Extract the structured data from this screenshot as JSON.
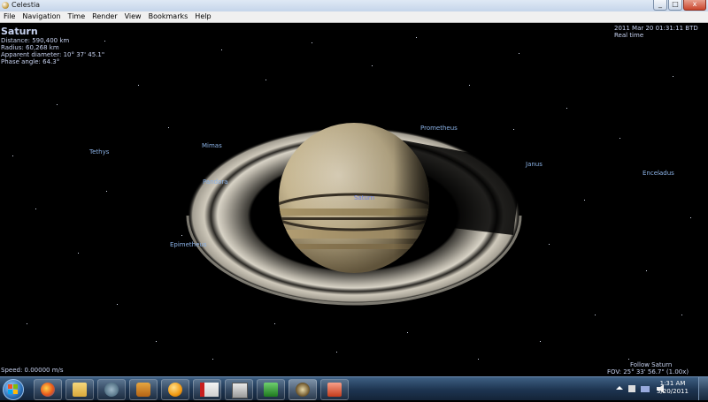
{
  "window": {
    "title": "Celestia",
    "controls": [
      "_",
      "□",
      "x"
    ]
  },
  "menu": [
    "File",
    "Navigation",
    "Time",
    "Render",
    "View",
    "Bookmarks",
    "Help"
  ],
  "overlay": {
    "object_name": "Saturn",
    "info_lines": [
      "Distance: 590,400 km",
      "Radius: 60,268 km",
      "Apparent diameter: 10° 37' 45.1\"",
      "Phase angle: 64.3°"
    ],
    "datetime": "2011 Mar 20 01:31:11 BTD",
    "time_mode": "Real time",
    "speed": "Speed: 0.00000 m/s",
    "follow": "Follow Saturn",
    "fov": "FOV: 25° 33' 56.7\" (1.00x)"
  },
  "labels": {
    "saturn": "Saturn",
    "moons": {
      "tethys": "Tethys",
      "mimas": "Mimas",
      "pandora": "Pandora",
      "epimetheus": "Epimetheus",
      "prometheus": "Prometheus",
      "janus": "Janus",
      "enceladus": "Enceladus"
    }
  },
  "taskbar": {
    "apps": [
      "start-orb",
      "firefox-icon",
      "explorer-icon",
      "app-icon",
      "media-player-icon",
      "orange-app-icon",
      "acrobat-icon",
      "program-icon",
      "excel-icon",
      "celestia-icon",
      "powerpoint-icon"
    ],
    "clock_time": "1:31 AM",
    "clock_date": "3/20/2011"
  },
  "colors": {
    "overlay_text": "#c7d2f0",
    "moon_label": "#8bb2e6",
    "saturn_label": "#6d82e8",
    "taskbar": "#1d3450"
  }
}
